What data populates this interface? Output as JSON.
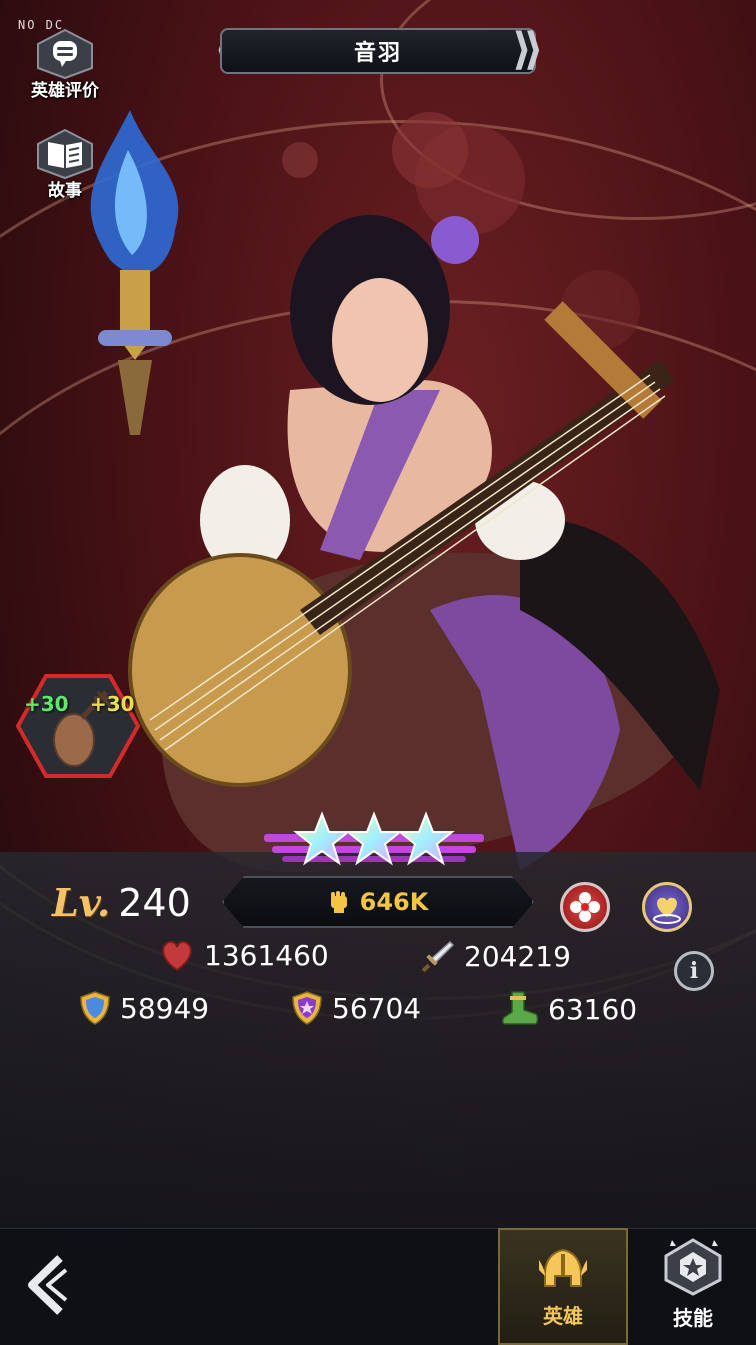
{
  "debug_tag": "NO DC",
  "side_buttons": {
    "rating_label": "英雄评价",
    "story_label": "故事"
  },
  "hero": {
    "name": "音羽"
  },
  "weapon": {
    "bonus_left": "+30",
    "bonus_right": "+30"
  },
  "stars": 3,
  "level": {
    "prefix": "Lv.",
    "value": "240"
  },
  "power": {
    "value": "646K"
  },
  "stats": {
    "hp": "1361460",
    "attack": "204219",
    "defense": "58949",
    "magic_defense": "56704",
    "speed": "63160"
  },
  "tabs": {
    "hero_label": "英雄",
    "skill_label": "技能"
  },
  "colors": {
    "accent_gold": "#f4c543",
    "bonus_green": "#5dea6a",
    "bonus_yellow": "#e8e04a"
  }
}
